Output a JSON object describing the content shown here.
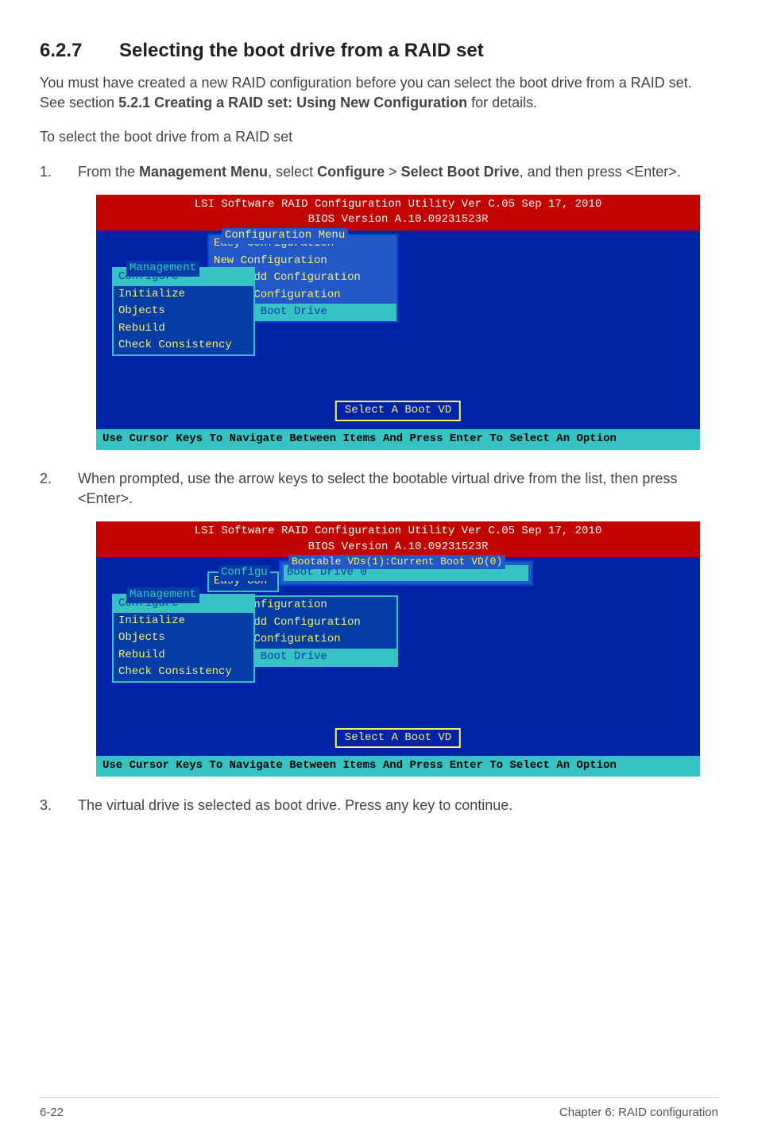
{
  "section": {
    "number": "6.2.7",
    "title": "Selecting the boot drive from a RAID set"
  },
  "intro": {
    "pre": "You must have created a new RAID configuration before you can select the boot drive from a RAID set. See section ",
    "bold": "5.2.1 Creating a RAID set: Using New Configuration",
    "post": " for details."
  },
  "toLine": "To select the boot drive from a RAID set",
  "step1": {
    "pre": "From the ",
    "b1": "Management Menu",
    "mid1": ", select ",
    "b2": "Configure",
    "mid2": " > ",
    "b3": "Select Boot Drive",
    "post": ", and then press <Enter>."
  },
  "step2": "When prompted, use the arrow keys to select the bootable virtual drive from the list, then press <Enter>.",
  "step3": "The virtual drive is selected as boot drive. Press any key to continue.",
  "bios": {
    "header1": "LSI Software RAID Configuration Utility Ver C.05 Sep 17, 2010",
    "header2": "BIOS Version  A.10.09231523R",
    "footer": "Use Cursor Keys To Navigate Between Items And Press Enter To Select An Option",
    "mgmtLabel": "Management",
    "mgmt": {
      "configure": "Configure",
      "initialize": "Initialize",
      "objects": "Objects",
      "rebuild": "Rebuild",
      "check": "Check Consistency"
    },
    "configLabel": "Configuration Menu",
    "config": {
      "easy": "Easy Configuration",
      "newcfg": "New Configuration",
      "viewadd": "View/Add Configuration",
      "clear": "Clear Configuration",
      "selectboot": "Select Boot Drive"
    },
    "bootvdLabel": "Select A Boot VD",
    "bootableLabel": "Bootable VDs(1):Current Boot VD(0)",
    "bootableItem": "Boot Drive 0",
    "configTrimLabel": "Configu",
    "easyTrim": "Easy Con"
  },
  "footer": {
    "page": "6-22",
    "chapter": "Chapter 6: RAID configuration"
  }
}
